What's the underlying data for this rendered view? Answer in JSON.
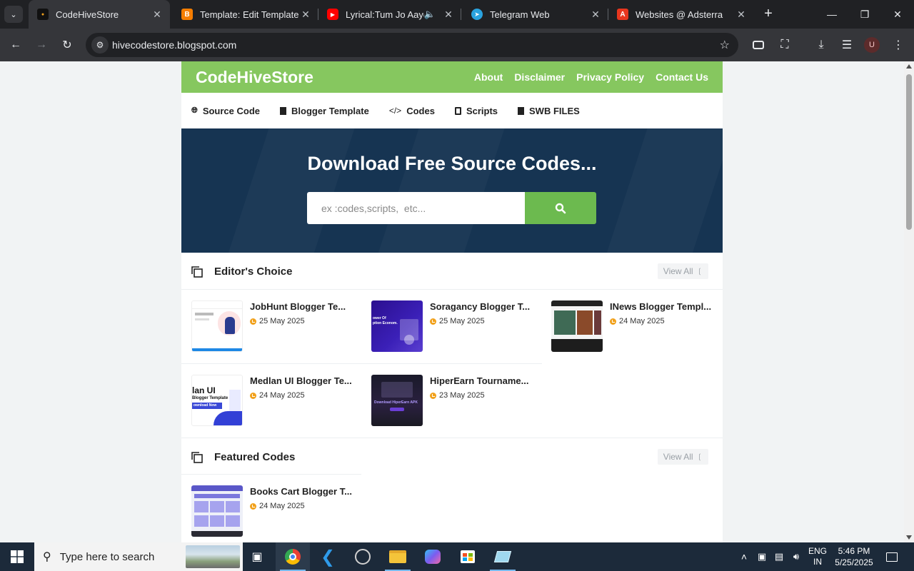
{
  "browser": {
    "tabs": [
      {
        "title": "CodeHiveStore",
        "active": true
      },
      {
        "title": "Template: Edit Template",
        "active": false
      },
      {
        "title": "Lyrical:Tum Jo Aaye |C",
        "active": false
      },
      {
        "title": "Telegram Web",
        "active": false
      },
      {
        "title": "Websites @ Adsterra",
        "active": false
      }
    ],
    "url": "hivecodestore.blogspot.com",
    "profile_initial": "U"
  },
  "site": {
    "logo": "CodeHiveStore",
    "top_nav": [
      "About",
      "Disclaimer",
      "Privacy Policy",
      "Contact Us"
    ],
    "categories": [
      "Source Code",
      "Blogger Template",
      "Codes",
      "Scripts",
      "SWB FILES"
    ],
    "hero_title": "Download Free Source Codes...",
    "search_placeholder": "ex :codes,scripts,  etc...",
    "sections": [
      {
        "title": "Editor's Choice",
        "view_all": "View All",
        "posts": [
          {
            "title": "JobHunt Blogger Te...",
            "date": "25 May 2025"
          },
          {
            "title": "Soragancy Blogger T...",
            "date": "25 May 2025"
          },
          {
            "title": "INews Blogger Templ...",
            "date": "24 May 2025"
          },
          {
            "title": "Medlan UI Blogger Te...",
            "date": "24 May 2025"
          },
          {
            "title": "HiperEarn Tourname...",
            "date": "23 May 2025"
          }
        ]
      },
      {
        "title": "Featured Codes",
        "view_all": "View All",
        "posts": [
          {
            "title": "Books Cart Blogger T...",
            "date": "24 May 2025"
          }
        ]
      }
    ],
    "thumb_texts": {
      "soragancy": "ower Of\nption Econom.",
      "medlan_big": "lan UI",
      "medlan_sub": "Blogger Template",
      "medlan_btn": "ownload Now",
      "hiperearn": "Download HiperEarn APK"
    }
  },
  "taskbar": {
    "search_placeholder": "Type here to search",
    "language": "ENG",
    "region": "IN",
    "time": "5:46 PM",
    "date": "5/25/2025"
  },
  "colors": {
    "header_green": "#86c75f",
    "search_green": "#6cba4f",
    "hero_navy": "#163452",
    "date_icon": "#f1a11c"
  }
}
